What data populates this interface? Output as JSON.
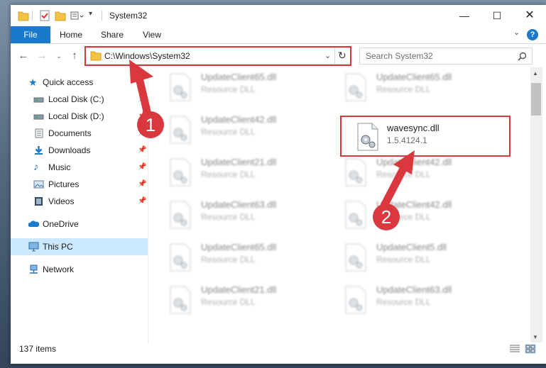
{
  "window": {
    "title": "System32"
  },
  "ribbon": {
    "tabs": [
      "File",
      "Home",
      "Share",
      "View"
    ]
  },
  "address": {
    "path": "C:\\Windows\\System32"
  },
  "search": {
    "placeholder": "Search System32"
  },
  "nav": {
    "items": [
      {
        "label": "Quick access",
        "icon": "star-icon",
        "pinned": false
      },
      {
        "label": "Local Disk (C:)",
        "icon": "drive-icon",
        "pinned": true
      },
      {
        "label": "Local Disk (D:)",
        "icon": "drive-icon",
        "pinned": true
      },
      {
        "label": "Documents",
        "icon": "documents-icon",
        "pinned": true
      },
      {
        "label": "Downloads",
        "icon": "downloads-icon",
        "pinned": true
      },
      {
        "label": "Music",
        "icon": "music-icon",
        "pinned": true
      },
      {
        "label": "Pictures",
        "icon": "pictures-icon",
        "pinned": true
      },
      {
        "label": "Videos",
        "icon": "videos-icon",
        "pinned": true
      },
      {
        "label": "OneDrive",
        "icon": "onedrive-icon",
        "pinned": false
      },
      {
        "label": "This PC",
        "icon": "computer-icon",
        "pinned": false,
        "selected": true
      },
      {
        "label": "Network",
        "icon": "network-icon",
        "pinned": false
      }
    ]
  },
  "files": {
    "left": [
      {
        "name": "UpdateClient65.dll",
        "sub": "Resource DLL"
      },
      {
        "name": "UpdateClient42.dll",
        "sub": "Resource DLL"
      },
      {
        "name": "UpdateClient21.dll",
        "sub": "Resource DLL"
      },
      {
        "name": "UpdateClient63.dll",
        "sub": "Resource DLL"
      },
      {
        "name": "UpdateClient65.dll",
        "sub": "Resource DLL"
      },
      {
        "name": "UpdateClient21.dll",
        "sub": "Resource DLL"
      }
    ],
    "right": [
      {
        "name": "UpdateClient65.dll",
        "sub": "Resource DLL"
      },
      {
        "name": "wavesync.dll",
        "sub": "1.5.4124.1",
        "highlight": true
      },
      {
        "name": "UpdateClient42.dll",
        "sub": "Resource DLL"
      },
      {
        "name": "UpdateClient42.dll",
        "sub": "Resource DLL"
      },
      {
        "name": "UpdateClient5.dll",
        "sub": "Resource DLL"
      },
      {
        "name": "UpdateClient63.dll",
        "sub": "Resource DLL"
      }
    ]
  },
  "status": {
    "items_count": "137 items"
  },
  "annotations": {
    "badge1": "1",
    "badge2": "2"
  },
  "colors": {
    "accent": "#1979ca",
    "annotation": "#d9383e",
    "selected": "#cce8ff"
  }
}
